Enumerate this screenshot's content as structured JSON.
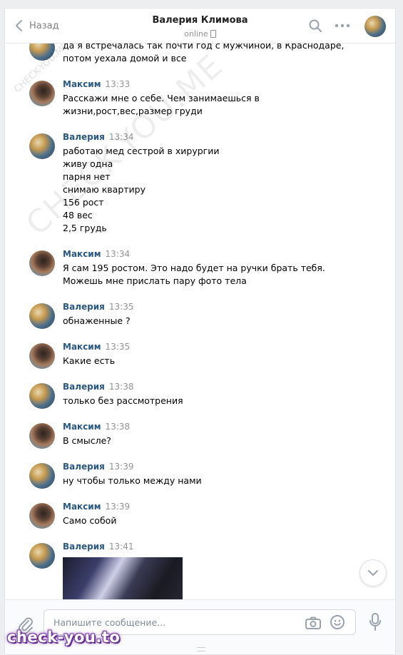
{
  "header": {
    "back_label": "Назад",
    "title": "Валерия Климова",
    "status": "online"
  },
  "messages": [
    {
      "author": "",
      "time": "",
      "text": "да я встречалась так почти год с мужчиной, в Краснодаре,\nпотом уехала домой и все",
      "avatar": "valeria"
    },
    {
      "author": "Максим",
      "time": "13:33",
      "text": "Расскажи мне о себе. Чем занимаешься в\nжизни,рост,вес,размер груди",
      "avatar": "maksim"
    },
    {
      "author": "Валерия",
      "time": "13:34",
      "text": "работаю мед сестрой в хирургии\nживу одна\nпарня нет\nснимаю квартиру\n156 рост\n48 вес\n2,5 грудь",
      "avatar": "valeria"
    },
    {
      "author": "Максим",
      "time": "13:34",
      "text": "Я сам 195 ростом. Это надо будет на ручки брать тебя.\nМожешь мне прислать пару фото тела",
      "avatar": "maksim"
    },
    {
      "author": "Валерия",
      "time": "13:35",
      "text": "обнаженные ?",
      "avatar": "valeria"
    },
    {
      "author": "Максим",
      "time": "13:35",
      "text": "Какие есть",
      "avatar": "maksim"
    },
    {
      "author": "Валерия",
      "time": "13:38",
      "text": "только без рассмотрения",
      "avatar": "valeria"
    },
    {
      "author": "Максим",
      "time": "13:38",
      "text": "В смысле?",
      "avatar": "maksim"
    },
    {
      "author": "Валерия",
      "time": "13:39",
      "text": "ну чтобы только между нами",
      "avatar": "valeria"
    },
    {
      "author": "Максим",
      "time": "13:39",
      "text": "Само собой",
      "avatar": "maksim"
    },
    {
      "author": "Валерия",
      "time": "13:41",
      "text": "",
      "avatar": "valeria",
      "has_photo": true
    }
  ],
  "composer": {
    "placeholder": "Напишите сообщение...",
    "value": ""
  },
  "watermarks": {
    "diagonal": "CHECK-YOU.ME",
    "small": "CHECK-YOU.ME",
    "badge": "check-you.to"
  },
  "icons": [
    "back-chevron-icon",
    "phone-icon",
    "search-icon",
    "more-icon",
    "chevron-down-icon",
    "paperclip-icon",
    "camera-icon",
    "smile-icon",
    "microphone-icon"
  ],
  "colors": {
    "author": "#2a5885",
    "time": "#939393",
    "badge_glow": "#7a3da0"
  }
}
